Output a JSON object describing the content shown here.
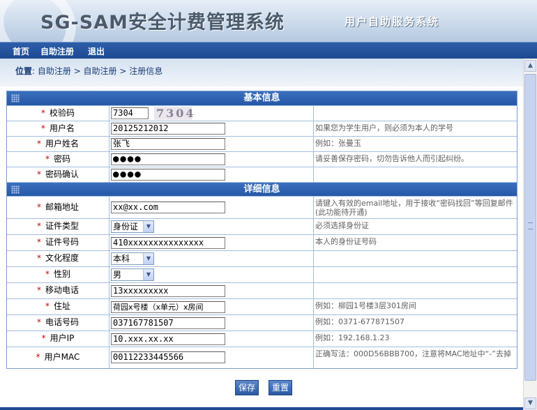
{
  "header": {
    "logo_text": "SG-SAM安全计费管理系统",
    "subtitle": "用户自助服务系统"
  },
  "nav": {
    "items": [
      "首页",
      "自助注册",
      "退出"
    ]
  },
  "breadcrumb": {
    "label": "位置",
    "path": ": 自助注册 > 自助注册 > 注册信息"
  },
  "sections": {
    "basic": "基本信息",
    "detail": "详细信息"
  },
  "fields": {
    "captcha": {
      "label": "校验码",
      "value": "7304",
      "image_text": "7304"
    },
    "username": {
      "label": "用户名",
      "value": "20125212012",
      "hint": "如果您为学生用户，则必须为本人的学号"
    },
    "realname": {
      "label": "用户姓名",
      "value": "张飞",
      "hint": "例如：张曼玉"
    },
    "password": {
      "label": "密码",
      "value": "●●●●",
      "hint": "请妥善保存密码，切勿告诉他人而引起纠纷。"
    },
    "password_confirm": {
      "label": "密码确认",
      "value": "●●●●"
    },
    "email": {
      "label": "邮箱地址",
      "value": "xx@xx.com",
      "hint": "请键入有效的email地址，用于接收“密码找回”等回复邮件(此功能待开通)"
    },
    "id_type": {
      "label": "证件类型",
      "value": "身份证",
      "hint": "必须选择身份证"
    },
    "id_number": {
      "label": "证件号码",
      "value": "410xxxxxxxxxxxxxxx",
      "hint": "本人的身份证号码"
    },
    "education": {
      "label": "文化程度",
      "value": "本科"
    },
    "gender": {
      "label": "性别",
      "value": "男"
    },
    "mobile": {
      "label": "移动电话",
      "value": "13xxxxxxxxx"
    },
    "address": {
      "label": "住址",
      "value": "荷园x号楼（x单元）x房间",
      "hint": "例如：柳园1号楼3层301房间"
    },
    "phone": {
      "label": "电话号码",
      "value": "037167781507",
      "hint": "例如：0371-677871507"
    },
    "ip": {
      "label": "用户IP",
      "value": "10.xxx.xx.xx",
      "hint": "例如：192.168.1.23"
    },
    "mac": {
      "label": "用户MAC",
      "value": "00112233445566",
      "hint": "正确写法：000D56BBB700，注意将MAC地址中“-”去掉"
    }
  },
  "buttons": {
    "save": "保存",
    "reset": "重置"
  },
  "colors": {
    "nav_bg": "#1d4a91",
    "section_bg": "#2558a6",
    "required_star": "#d40000"
  }
}
